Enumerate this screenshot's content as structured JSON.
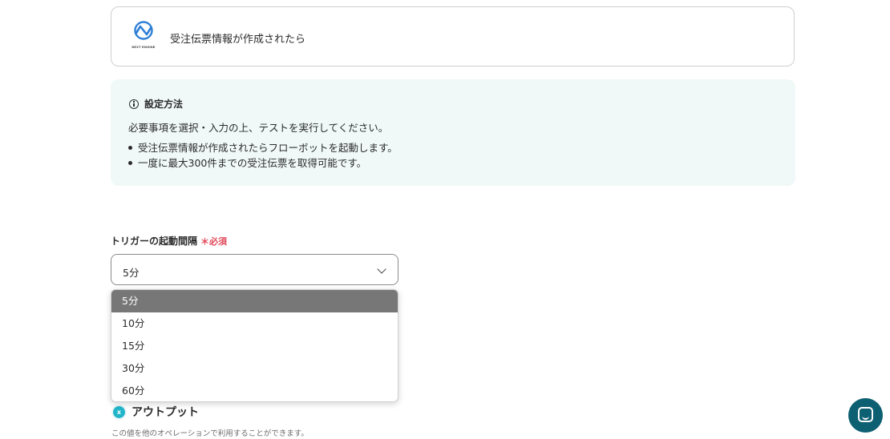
{
  "trigger_app": {
    "logo_text": "NEXT ENGINE",
    "title": "受注伝票情報が作成されたら"
  },
  "instructions": {
    "title": "設定方法",
    "description": "必要事項を選択・入力の上、テストを実行してください。",
    "items": [
      "受注伝票情報が作成されたらフローボットを起動します。",
      "一度に最大300件までの受注伝票を取得可能です。"
    ]
  },
  "interval_field": {
    "label": "トリガーの起動間隔",
    "required_mark": "＊必須",
    "value": "5分",
    "options": [
      "5分",
      "10分",
      "15分",
      "30分",
      "60分"
    ]
  },
  "output": {
    "title": "アウトプット",
    "description": "この値を他のオペレーションで利用することができます。"
  },
  "colors": {
    "accent_teal": "#0d5f72",
    "required_red": "#e0495a",
    "info_bg": "#f0f9f8",
    "selected_option_bg": "#777777"
  }
}
